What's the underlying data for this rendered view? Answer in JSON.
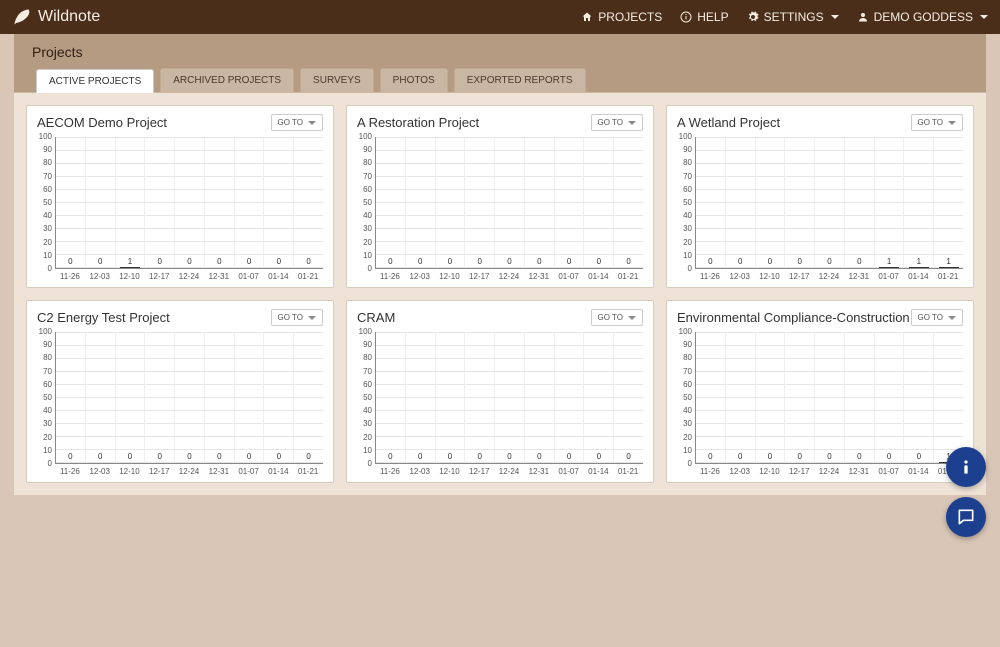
{
  "brand": "Wildnote",
  "nav": {
    "projects": "PROJECTS",
    "help": "HELP",
    "settings": "SETTINGS",
    "user": "DEMO GODDESS"
  },
  "page_title": "Projects",
  "tabs": [
    {
      "label": "ACTIVE PROJECTS",
      "active": true
    },
    {
      "label": "ARCHIVED PROJECTS",
      "active": false
    },
    {
      "label": "SURVEYS",
      "active": false
    },
    {
      "label": "PHOTOS",
      "active": false
    },
    {
      "label": "EXPORTED REPORTS",
      "active": false
    }
  ],
  "goto_label": "GO TO",
  "chart_data": [
    {
      "title": "AECOM Demo Project",
      "type": "bar",
      "ylim": [
        0,
        100
      ],
      "yticks": [
        100,
        90,
        80,
        70,
        60,
        50,
        40,
        30,
        20,
        10,
        0
      ],
      "categories": [
        "11-26",
        "12-03",
        "12-10",
        "12-17",
        "12-24",
        "12-31",
        "01-07",
        "01-14",
        "01-21"
      ],
      "values": [
        0,
        0,
        1,
        0,
        0,
        0,
        0,
        0,
        0
      ]
    },
    {
      "title": "A Restoration Project",
      "type": "bar",
      "ylim": [
        0,
        100
      ],
      "yticks": [
        100,
        90,
        80,
        70,
        60,
        50,
        40,
        30,
        20,
        10,
        0
      ],
      "categories": [
        "11-26",
        "12-03",
        "12-10",
        "12-17",
        "12-24",
        "12-31",
        "01-07",
        "01-14",
        "01-21"
      ],
      "values": [
        0,
        0,
        0,
        0,
        0,
        0,
        0,
        0,
        0
      ]
    },
    {
      "title": "A Wetland Project",
      "type": "bar",
      "ylim": [
        0,
        100
      ],
      "yticks": [
        100,
        90,
        80,
        70,
        60,
        50,
        40,
        30,
        20,
        10,
        0
      ],
      "categories": [
        "11-26",
        "12-03",
        "12-10",
        "12-17",
        "12-24",
        "12-31",
        "01-07",
        "01-14",
        "01-21"
      ],
      "values": [
        0,
        0,
        0,
        0,
        0,
        0,
        1,
        1,
        1
      ]
    },
    {
      "title": "C2 Energy Test Project",
      "type": "bar",
      "ylim": [
        0,
        100
      ],
      "yticks": [
        100,
        90,
        80,
        70,
        60,
        50,
        40,
        30,
        20,
        10,
        0
      ],
      "categories": [
        "11-26",
        "12-03",
        "12-10",
        "12-17",
        "12-24",
        "12-31",
        "01-07",
        "01-14",
        "01-21"
      ],
      "values": [
        0,
        0,
        0,
        0,
        0,
        0,
        0,
        0,
        0
      ]
    },
    {
      "title": "CRAM",
      "type": "bar",
      "ylim": [
        0,
        100
      ],
      "yticks": [
        100,
        90,
        80,
        70,
        60,
        50,
        40,
        30,
        20,
        10,
        0
      ],
      "categories": [
        "11-26",
        "12-03",
        "12-10",
        "12-17",
        "12-24",
        "12-31",
        "01-07",
        "01-14",
        "01-21"
      ],
      "values": [
        0,
        0,
        0,
        0,
        0,
        0,
        0,
        0,
        0
      ]
    },
    {
      "title": "Environmental Compliance-Construction",
      "type": "bar",
      "ylim": [
        0,
        100
      ],
      "yticks": [
        100,
        90,
        80,
        70,
        60,
        50,
        40,
        30,
        20,
        10,
        0
      ],
      "categories": [
        "11-26",
        "12-03",
        "12-10",
        "12-17",
        "12-24",
        "12-31",
        "01-07",
        "01-14",
        "01-21"
      ],
      "values": [
        0,
        0,
        0,
        0,
        0,
        0,
        0,
        0,
        1
      ]
    }
  ]
}
